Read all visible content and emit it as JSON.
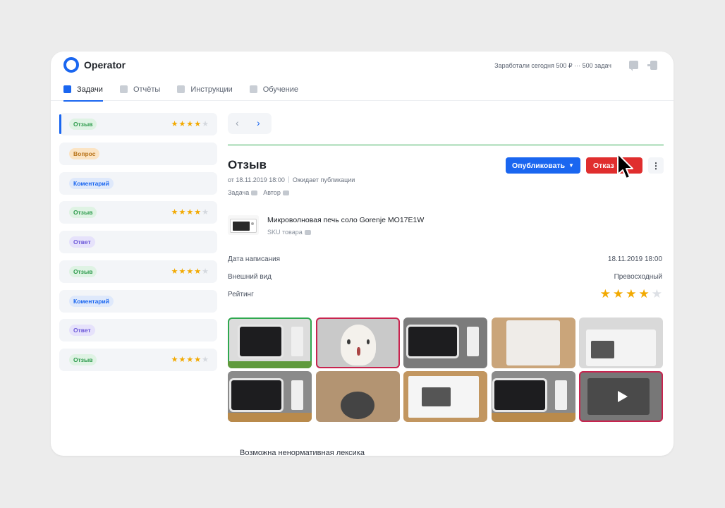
{
  "app": {
    "name": "Operator",
    "earned_text": "Заработали сегодня 500 ₽ ··· 500 задач"
  },
  "header_icons": {
    "chat": "chat-icon",
    "logout": "logout-icon"
  },
  "tabs": [
    {
      "label": "Задачи",
      "icon": "tasks-icon",
      "active": true
    },
    {
      "label": "Отчёты",
      "icon": "reports-icon",
      "active": false
    },
    {
      "label": "Инструкции",
      "icon": "instructions-icon",
      "active": false
    },
    {
      "label": "Обучение",
      "icon": "education-icon",
      "active": false
    }
  ],
  "sidebar": {
    "items": [
      {
        "label": "Отзыв",
        "color": "green",
        "rating": 4
      },
      {
        "label": "Вопрос",
        "color": "orange",
        "rating": null
      },
      {
        "label": "Коментарий",
        "color": "blue",
        "rating": null
      },
      {
        "label": "Отзыв",
        "color": "green",
        "rating": 4
      },
      {
        "label": "Ответ",
        "color": "purple",
        "rating": null
      },
      {
        "label": "Отзыв",
        "color": "green",
        "rating": 4
      },
      {
        "label": "Коментарий",
        "color": "blue",
        "rating": null
      },
      {
        "label": "Ответ",
        "color": "purple",
        "rating": null
      },
      {
        "label": "Отзыв",
        "color": "green",
        "rating": 4
      }
    ]
  },
  "pager": {
    "prev": "‹",
    "next": "›"
  },
  "review": {
    "title": "Отзыв",
    "date": "от 18.11.2019 18:00",
    "status": "Ожидает публикации",
    "link_task": "Задача",
    "link_author": "Автор",
    "publish_label": "Опубликовать",
    "reject_label": "Отказ",
    "more_label": "⋮"
  },
  "product": {
    "name": "Микроволновая печь соло Gorenje MO17E1W",
    "sku_label": "SKU товара"
  },
  "details": {
    "written_label": "Дата написания",
    "written_value": "18.11.2019 18:00",
    "look_label": "Внешний вид",
    "look_value": "Превосходный",
    "rating_label": "Рейтинг",
    "rating_value": 4,
    "rating_max": 5
  },
  "gallery_count": 10,
  "warning": "Возможна ненормативная лексика",
  "colors": {
    "accent": "#1a66f0",
    "danger": "#e02e2e",
    "success": "#2fa84f",
    "star": "#f2a900"
  }
}
